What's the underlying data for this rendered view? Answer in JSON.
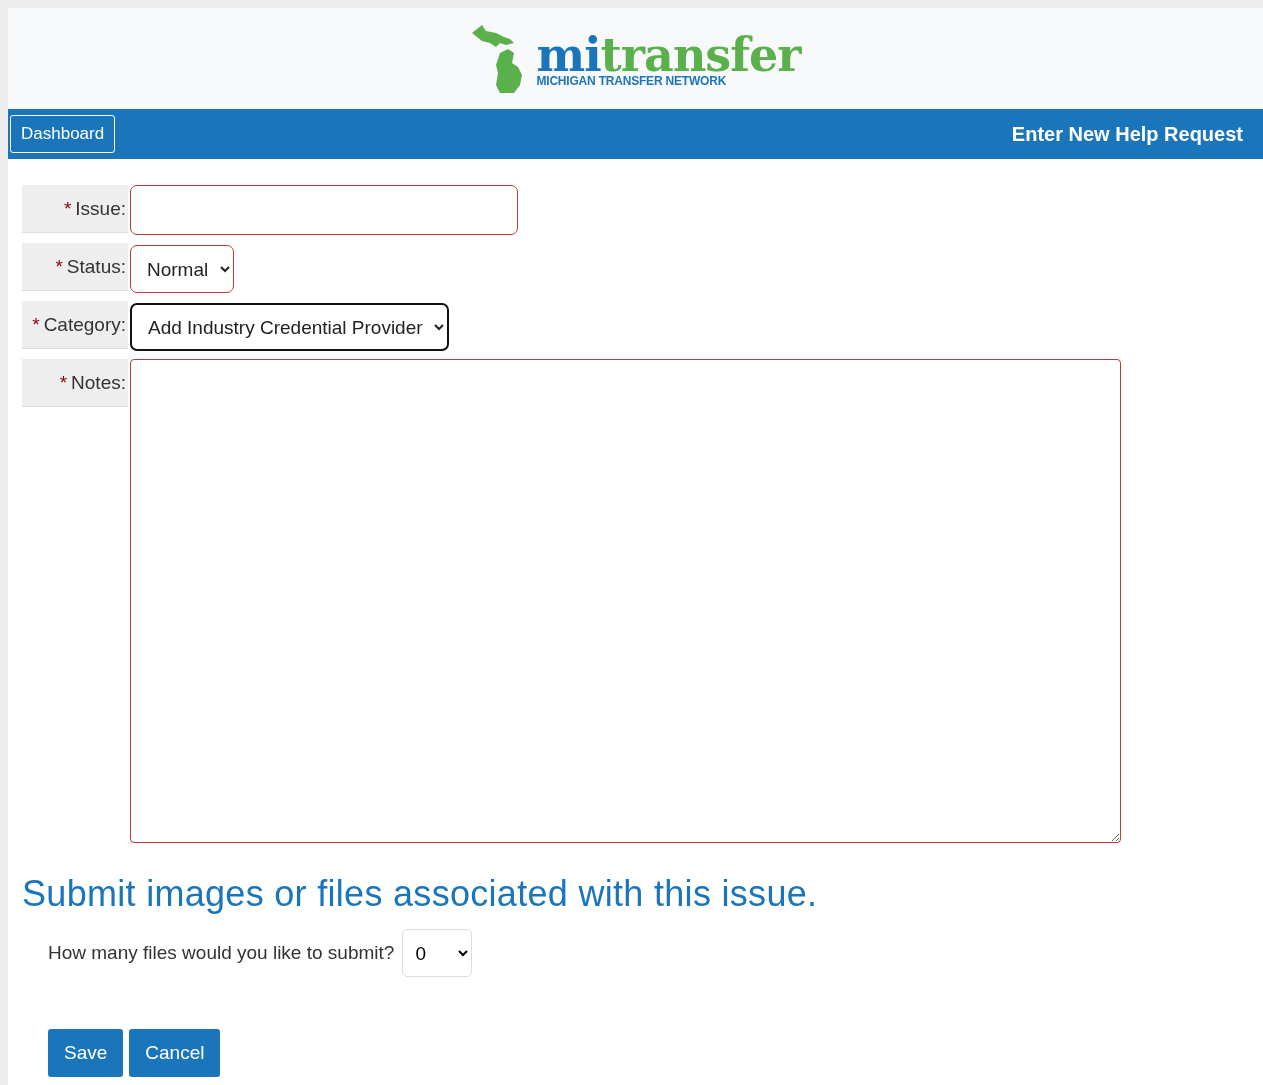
{
  "logo": {
    "prefix": "mi",
    "word": "transfer",
    "tagline": "MICHIGAN TRANSFER NETWORK"
  },
  "nav": {
    "button": "Dashboard",
    "title": "Enter New Help Request"
  },
  "fields": [
    {
      "kind": "text",
      "label": "Issue:",
      "required_mark": "*",
      "invalid": true
    },
    {
      "kind": "select",
      "label": "Status:",
      "required_mark": "*",
      "invalid": true,
      "value": "Normal"
    },
    {
      "kind": "select",
      "label": "Category:",
      "required_mark": "*",
      "invalid": false,
      "value": "Add Industry Credential Provider"
    },
    {
      "kind": "textarea",
      "label": "Notes:",
      "required_mark": "*",
      "invalid": true
    }
  ],
  "files": {
    "heading": "Submit images or files associated with this issue.",
    "question": "How many files would you like to submit?",
    "count": "0"
  },
  "buttons": [
    "Save",
    "Cancel"
  ]
}
